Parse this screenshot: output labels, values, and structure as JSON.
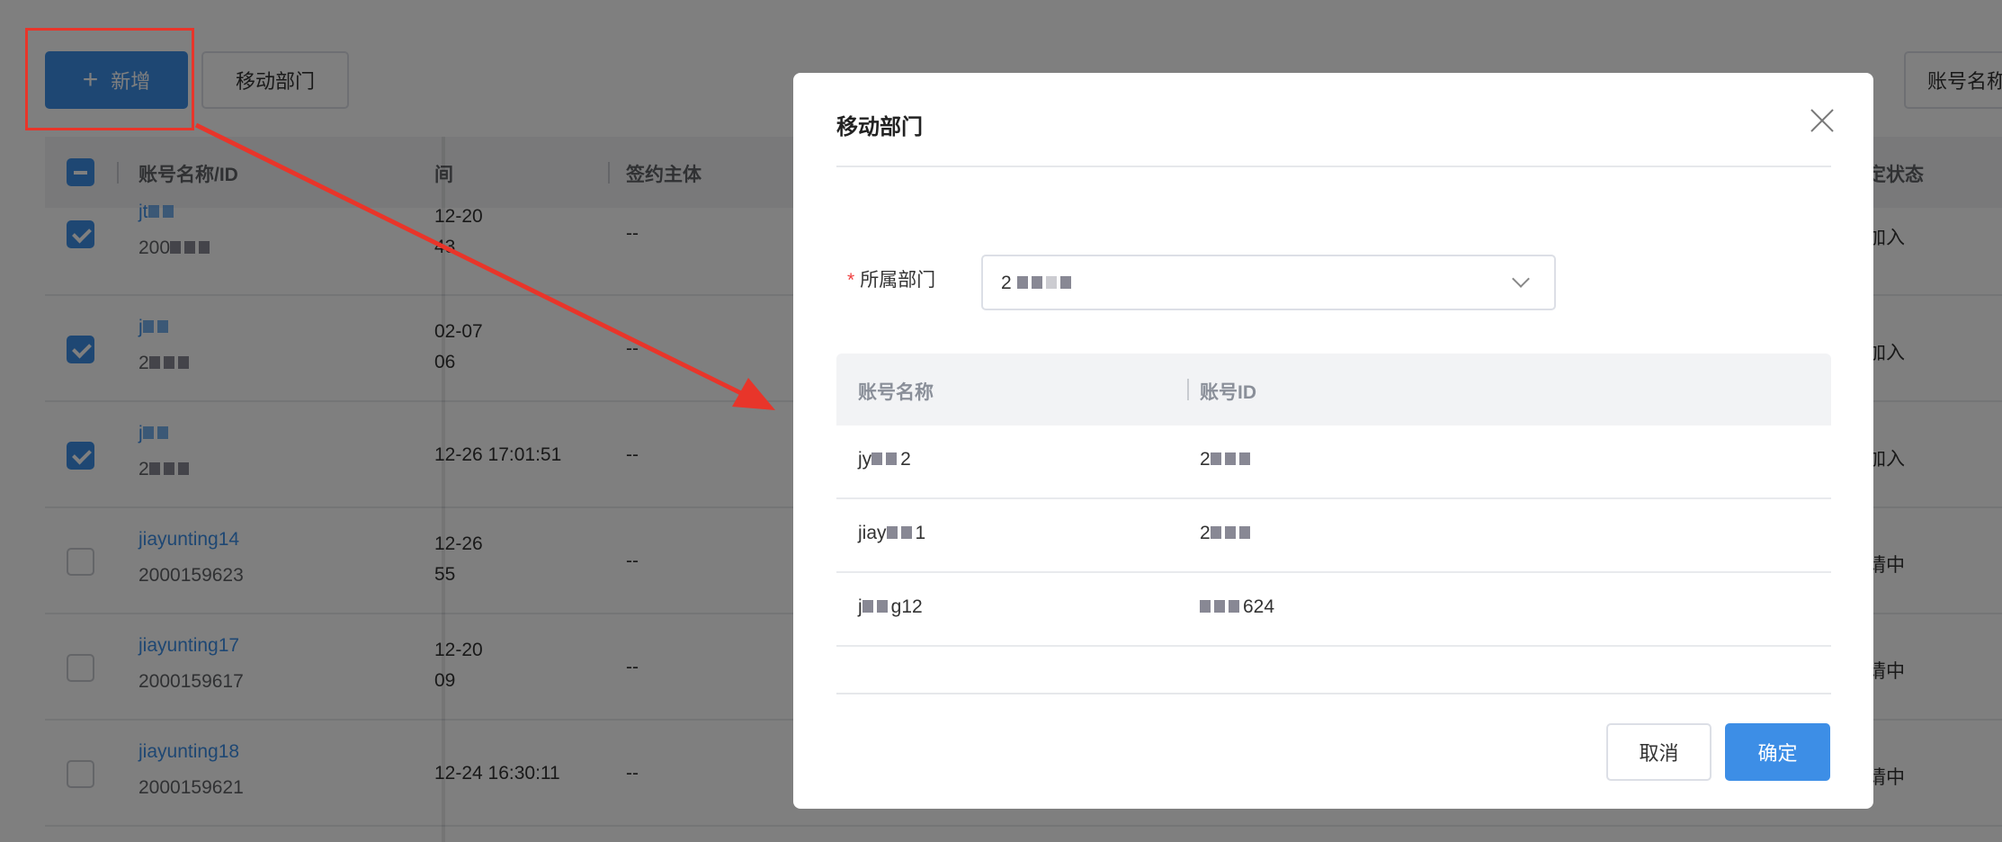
{
  "toolbar": {
    "add_label": "新增",
    "add_icon": "plus-icon",
    "move_label": "移动部门",
    "search_label": "账号名称"
  },
  "table": {
    "headers": {
      "name_id": "账号名称/ID",
      "time": "间",
      "party": "签约主体",
      "status": "定状态"
    },
    "rows": [
      {
        "checked": true,
        "name": "jt",
        "id": "200",
        "time1": "12-20",
        "time2": "43",
        "party": "--",
        "status": "加入"
      },
      {
        "checked": true,
        "name": "j",
        "id": "2",
        "time1": "02-07",
        "time2": "06",
        "party": "--",
        "status": "加入"
      },
      {
        "checked": true,
        "name": "j",
        "id": "2",
        "time1": "12-26 17:01:51",
        "time2": "",
        "party": "--",
        "status": "加入"
      },
      {
        "checked": false,
        "name": "jiayunting14",
        "id": "2000159623",
        "time1": "12-26",
        "time2": "55",
        "party": "--",
        "status": "请中"
      },
      {
        "checked": false,
        "name": "jiayunting17",
        "id": "2000159617",
        "time1": "12-20",
        "time2": "09",
        "party": "--",
        "status": "请中"
      },
      {
        "checked": false,
        "name": "jiayunting18",
        "id": "2000159621",
        "time1": "12-24 16:30:11",
        "time2": "",
        "party": "--",
        "status": "请中"
      }
    ]
  },
  "modal": {
    "title": "移动部门",
    "field_label": "所属部门",
    "required_mark": "*",
    "select_value": "2",
    "columns": {
      "name": "账号名称",
      "id": "账号ID"
    },
    "rows": [
      {
        "name": "jy",
        "name_tail": "2",
        "id": "2",
        "id_tail": ""
      },
      {
        "name": "jiay",
        "name_tail": "1",
        "id": "2",
        "id_tail": ""
      },
      {
        "name": "j",
        "name_tail": "g12",
        "id": "",
        "id_tail": "624"
      }
    ],
    "cancel_label": "取消",
    "confirm_label": "确定"
  },
  "colors": {
    "primary": "#3d8ee6",
    "annotation": "#e8352a"
  }
}
